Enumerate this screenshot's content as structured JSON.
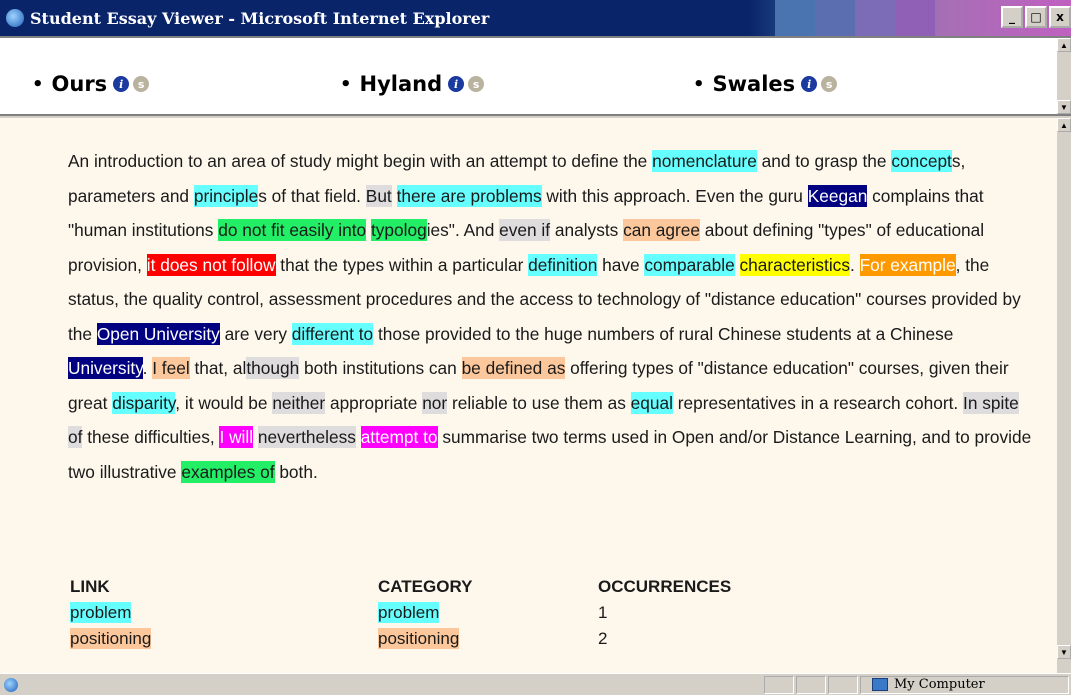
{
  "window": {
    "title": "Student Essay Viewer - Microsoft Internet Explorer",
    "minimize": "_",
    "restore": "□",
    "close": "x"
  },
  "nav": {
    "items": [
      {
        "label": "Ours",
        "info_icon": "info-icon",
        "sum_icon": "s-icon"
      },
      {
        "label": "Hyland",
        "info_icon": "info-icon",
        "sum_icon": "s-icon"
      },
      {
        "label": "Swales",
        "info_icon": "info-icon",
        "sum_icon": "s-icon"
      }
    ],
    "bullet": "•",
    "info_glyph": "i",
    "sum_glyph": "s"
  },
  "essay": {
    "highlight_colors": {
      "cyan": "#66ffff",
      "green": "#22ee66",
      "peach": "#fcc89b",
      "gray": "#dedcdc",
      "red": "#ff0000",
      "yellow": "#ffff00",
      "orange": "#ff9900",
      "navy": "#000080",
      "magenta": "#ff00ff"
    },
    "segments": [
      {
        "t": "An introduction to an area of study might begin with an attempt to define the "
      },
      {
        "t": "nomenclature",
        "c": "cyan"
      },
      {
        "t": " and to grasp the "
      },
      {
        "t": "concept",
        "c": "cyan"
      },
      {
        "t": "s, parameters and "
      },
      {
        "t": "principle",
        "c": "cyan"
      },
      {
        "t": "s of that field. "
      },
      {
        "t": "But",
        "c": "gray"
      },
      {
        "t": " "
      },
      {
        "t": "there are problems",
        "c": "cyan"
      },
      {
        "t": " with this approach. Even the guru "
      },
      {
        "t": "Keegan",
        "c": "navy"
      },
      {
        "t": " complains that \"human institutions "
      },
      {
        "t": "do not fit easily into",
        "c": "green"
      },
      {
        "t": " "
      },
      {
        "t": "typolog",
        "c": "green"
      },
      {
        "t": "ies\". And "
      },
      {
        "t": "even if",
        "c": "gray"
      },
      {
        "t": " analysts "
      },
      {
        "t": "can agree",
        "c": "peach"
      },
      {
        "t": " about defining \"types\" of educational provision, "
      },
      {
        "t": "it does not follow",
        "c": "red"
      },
      {
        "t": " that the types within a particular "
      },
      {
        "t": "definition",
        "c": "cyan"
      },
      {
        "t": " have "
      },
      {
        "t": "comparable",
        "c": "cyan"
      },
      {
        "t": " "
      },
      {
        "t": "characteristics",
        "c": "yellow"
      },
      {
        "t": ". "
      },
      {
        "t": "For example",
        "c": "orange"
      },
      {
        "t": ", the status, the quality control, assessment procedures and the access to technology of \"distance education\" courses provided by the "
      },
      {
        "t": "Open University",
        "c": "navy"
      },
      {
        "t": " are very "
      },
      {
        "t": "different to",
        "c": "cyan"
      },
      {
        "t": " those provided to the huge numbers of rural Chinese students at a Chinese "
      },
      {
        "t": "University",
        "c": "navy"
      },
      {
        "t": ". "
      },
      {
        "t": "I feel",
        "c": "peach"
      },
      {
        "t": " that, al"
      },
      {
        "t": "though",
        "c": "gray"
      },
      {
        "t": " both institutions can "
      },
      {
        "t": "be defined as",
        "c": "peach"
      },
      {
        "t": " offering types of \"distance education\" courses, given their great "
      },
      {
        "t": "disparity",
        "c": "cyan"
      },
      {
        "t": ", it would be "
      },
      {
        "t": "neither",
        "c": "gray"
      },
      {
        "t": " appropriate "
      },
      {
        "t": "nor",
        "c": "gray"
      },
      {
        "t": " reliable to use them as "
      },
      {
        "t": "equal",
        "c": "cyan"
      },
      {
        "t": " representatives in a research cohort. "
      },
      {
        "t": "In spite of",
        "c": "gray"
      },
      {
        "t": " these difficulties, "
      },
      {
        "t": "I will",
        "c": "magenta"
      },
      {
        "t": " "
      },
      {
        "t": "nevertheless",
        "c": "gray"
      },
      {
        "t": " "
      },
      {
        "t": "attempt to",
        "c": "magenta"
      },
      {
        "t": " summarise two terms used in Open and/or Distance Learning, and to provide two illustrative "
      },
      {
        "t": "examples of",
        "c": "green"
      },
      {
        "t": " both."
      }
    ]
  },
  "links_table": {
    "headers": [
      "LINK",
      "CATEGORY",
      "OCCURRENCES"
    ],
    "rows": [
      {
        "link": "problem",
        "category": "problem",
        "occurrences": "1",
        "c": "cyan"
      },
      {
        "link": "positioning",
        "category": "positioning",
        "occurrences": "2",
        "c": "peach"
      }
    ]
  },
  "status": {
    "zone": "My Computer"
  }
}
